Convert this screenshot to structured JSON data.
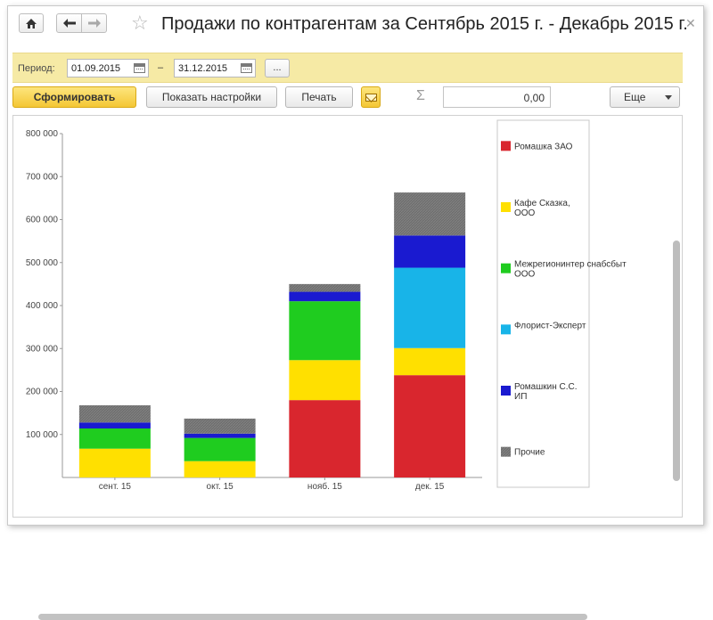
{
  "nav": {
    "home_icon": "home-icon",
    "back_icon": "arrow-left-icon",
    "forward_icon": "arrow-right-icon",
    "favorite_icon": "star-icon",
    "close_icon": "close-icon"
  },
  "window": {
    "title": "Продажи по контрагентам за Сентябрь 2015 г. - Декабрь 2015 г."
  },
  "period": {
    "label": "Период:",
    "from": "01.09.2015",
    "to": "31.12.2015",
    "separator": "–",
    "more_label": "..."
  },
  "toolbar": {
    "generate_label": "Сформировать",
    "settings_label": "Показать настройки",
    "print_label": "Печать",
    "sigma": "Σ",
    "sum_value": "0,00",
    "more_label": "Еще"
  },
  "chart_data": {
    "type": "bar",
    "stacked": true,
    "categories": [
      "сент. 15",
      "окт. 15",
      "нояб. 15",
      "дек. 15"
    ],
    "ylim": [
      0,
      800000
    ],
    "yticks": [
      100000,
      200000,
      300000,
      400000,
      500000,
      600000,
      700000,
      800000
    ],
    "ytick_labels": [
      "100 000",
      "200 000",
      "300 000",
      "400 000",
      "500 000",
      "600 000",
      "700 000",
      "800 000"
    ],
    "legend_position": "right",
    "grid": false,
    "series": [
      {
        "name": "Ромашка ЗАО",
        "color": "#d9262e",
        "values": [
          0,
          0,
          180000,
          238000
        ]
      },
      {
        "name": "Кафе Сказка, ООО",
        "color": "#ffe000",
        "values": [
          67000,
          38000,
          93000,
          63000
        ]
      },
      {
        "name": "Межрегионинтер снабсбыт ООО",
        "color": "#1fcc1f",
        "values": [
          47000,
          54000,
          137000,
          0
        ]
      },
      {
        "name": "Флорист-Эксперт",
        "color": "#18b4e8",
        "values": [
          0,
          0,
          0,
          187000
        ]
      },
      {
        "name": "Ромашкин С.С. ИП",
        "color": "#1a1ad0",
        "values": [
          14000,
          10000,
          22000,
          75000
        ]
      },
      {
        "name": "Прочие",
        "color": "#707070",
        "values": [
          40000,
          35000,
          18000,
          100000
        ]
      }
    ]
  }
}
